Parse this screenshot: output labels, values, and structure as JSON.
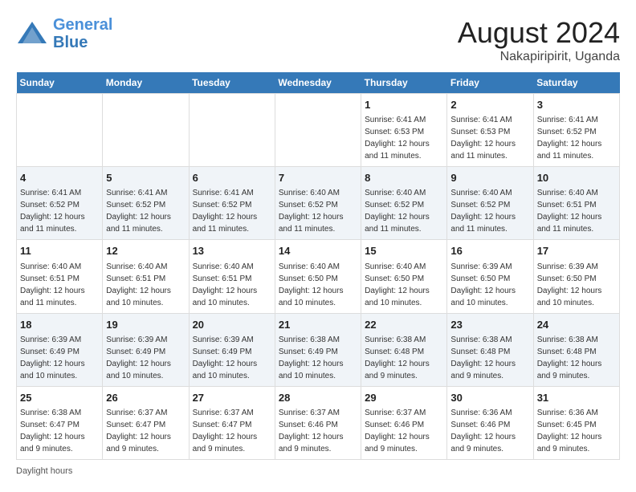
{
  "header": {
    "logo_line1": "General",
    "logo_line2": "Blue",
    "title": "August 2024",
    "subtitle": "Nakapiripirit, Uganda"
  },
  "days_of_week": [
    "Sunday",
    "Monday",
    "Tuesday",
    "Wednesday",
    "Thursday",
    "Friday",
    "Saturday"
  ],
  "weeks": [
    [
      {
        "day": "",
        "info": ""
      },
      {
        "day": "",
        "info": ""
      },
      {
        "day": "",
        "info": ""
      },
      {
        "day": "",
        "info": ""
      },
      {
        "day": "1",
        "info": "Sunrise: 6:41 AM\nSunset: 6:53 PM\nDaylight: 12 hours and 11 minutes."
      },
      {
        "day": "2",
        "info": "Sunrise: 6:41 AM\nSunset: 6:53 PM\nDaylight: 12 hours and 11 minutes."
      },
      {
        "day": "3",
        "info": "Sunrise: 6:41 AM\nSunset: 6:52 PM\nDaylight: 12 hours and 11 minutes."
      }
    ],
    [
      {
        "day": "4",
        "info": "Sunrise: 6:41 AM\nSunset: 6:52 PM\nDaylight: 12 hours and 11 minutes."
      },
      {
        "day": "5",
        "info": "Sunrise: 6:41 AM\nSunset: 6:52 PM\nDaylight: 12 hours and 11 minutes."
      },
      {
        "day": "6",
        "info": "Sunrise: 6:41 AM\nSunset: 6:52 PM\nDaylight: 12 hours and 11 minutes."
      },
      {
        "day": "7",
        "info": "Sunrise: 6:40 AM\nSunset: 6:52 PM\nDaylight: 12 hours and 11 minutes."
      },
      {
        "day": "8",
        "info": "Sunrise: 6:40 AM\nSunset: 6:52 PM\nDaylight: 12 hours and 11 minutes."
      },
      {
        "day": "9",
        "info": "Sunrise: 6:40 AM\nSunset: 6:52 PM\nDaylight: 12 hours and 11 minutes."
      },
      {
        "day": "10",
        "info": "Sunrise: 6:40 AM\nSunset: 6:51 PM\nDaylight: 12 hours and 11 minutes."
      }
    ],
    [
      {
        "day": "11",
        "info": "Sunrise: 6:40 AM\nSunset: 6:51 PM\nDaylight: 12 hours and 11 minutes."
      },
      {
        "day": "12",
        "info": "Sunrise: 6:40 AM\nSunset: 6:51 PM\nDaylight: 12 hours and 10 minutes."
      },
      {
        "day": "13",
        "info": "Sunrise: 6:40 AM\nSunset: 6:51 PM\nDaylight: 12 hours and 10 minutes."
      },
      {
        "day": "14",
        "info": "Sunrise: 6:40 AM\nSunset: 6:50 PM\nDaylight: 12 hours and 10 minutes."
      },
      {
        "day": "15",
        "info": "Sunrise: 6:40 AM\nSunset: 6:50 PM\nDaylight: 12 hours and 10 minutes."
      },
      {
        "day": "16",
        "info": "Sunrise: 6:39 AM\nSunset: 6:50 PM\nDaylight: 12 hours and 10 minutes."
      },
      {
        "day": "17",
        "info": "Sunrise: 6:39 AM\nSunset: 6:50 PM\nDaylight: 12 hours and 10 minutes."
      }
    ],
    [
      {
        "day": "18",
        "info": "Sunrise: 6:39 AM\nSunset: 6:49 PM\nDaylight: 12 hours and 10 minutes."
      },
      {
        "day": "19",
        "info": "Sunrise: 6:39 AM\nSunset: 6:49 PM\nDaylight: 12 hours and 10 minutes."
      },
      {
        "day": "20",
        "info": "Sunrise: 6:39 AM\nSunset: 6:49 PM\nDaylight: 12 hours and 10 minutes."
      },
      {
        "day": "21",
        "info": "Sunrise: 6:38 AM\nSunset: 6:49 PM\nDaylight: 12 hours and 10 minutes."
      },
      {
        "day": "22",
        "info": "Sunrise: 6:38 AM\nSunset: 6:48 PM\nDaylight: 12 hours and 9 minutes."
      },
      {
        "day": "23",
        "info": "Sunrise: 6:38 AM\nSunset: 6:48 PM\nDaylight: 12 hours and 9 minutes."
      },
      {
        "day": "24",
        "info": "Sunrise: 6:38 AM\nSunset: 6:48 PM\nDaylight: 12 hours and 9 minutes."
      }
    ],
    [
      {
        "day": "25",
        "info": "Sunrise: 6:38 AM\nSunset: 6:47 PM\nDaylight: 12 hours and 9 minutes."
      },
      {
        "day": "26",
        "info": "Sunrise: 6:37 AM\nSunset: 6:47 PM\nDaylight: 12 hours and 9 minutes."
      },
      {
        "day": "27",
        "info": "Sunrise: 6:37 AM\nSunset: 6:47 PM\nDaylight: 12 hours and 9 minutes."
      },
      {
        "day": "28",
        "info": "Sunrise: 6:37 AM\nSunset: 6:46 PM\nDaylight: 12 hours and 9 minutes."
      },
      {
        "day": "29",
        "info": "Sunrise: 6:37 AM\nSunset: 6:46 PM\nDaylight: 12 hours and 9 minutes."
      },
      {
        "day": "30",
        "info": "Sunrise: 6:36 AM\nSunset: 6:46 PM\nDaylight: 12 hours and 9 minutes."
      },
      {
        "day": "31",
        "info": "Sunrise: 6:36 AM\nSunset: 6:45 PM\nDaylight: 12 hours and 9 minutes."
      }
    ]
  ],
  "footer": {
    "text": "Daylight hours",
    "url": "https://www.generalblue.com"
  }
}
